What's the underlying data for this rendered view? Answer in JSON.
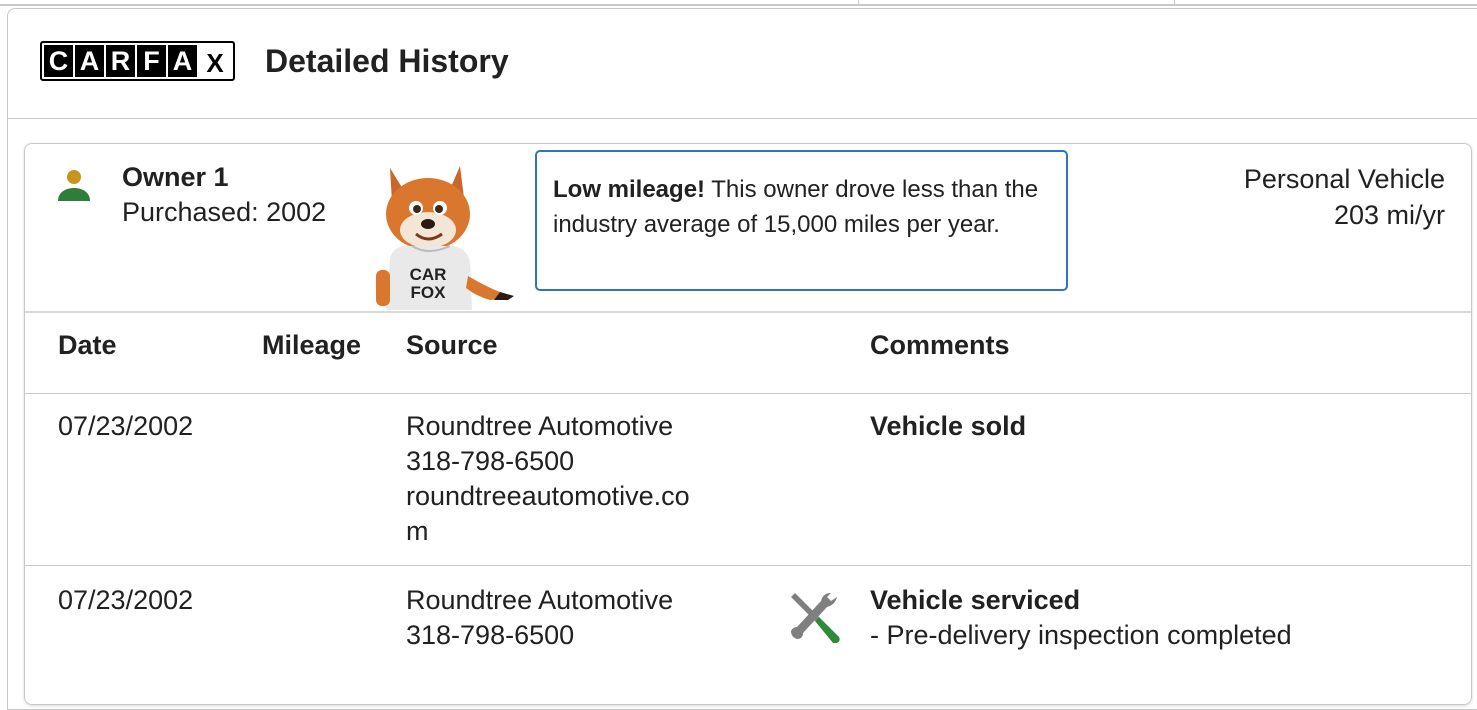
{
  "header": {
    "logo_letters": [
      "C",
      "A",
      "R",
      "F",
      "A",
      "X"
    ],
    "title": "Detailed History"
  },
  "owner": {
    "label": "Owner 1",
    "purchased": "Purchased: 2002",
    "callout_bold": "Low mileage!",
    "callout_text": " This owner drove less than the industry average of 15,000 miles per year.",
    "usage_type": "Personal Vehicle",
    "usage_rate": "203 mi/yr",
    "fox_shirt": "CAR FOX"
  },
  "table": {
    "headers": {
      "date": "Date",
      "mileage": "Mileage",
      "source": "Source",
      "comments": "Comments"
    },
    "rows": [
      {
        "date": "07/23/2002",
        "mileage": "",
        "source": [
          "Roundtree Automotive",
          "318-798-6500",
          "roundtreeautomotive.co",
          "m"
        ],
        "comment_title": "Vehicle sold",
        "comment_detail": ""
      },
      {
        "date": "07/23/2002",
        "mileage": "",
        "source": [
          "Roundtree Automotive",
          "318-798-6500"
        ],
        "icon": "service-wrench-icon",
        "comment_title": "Vehicle serviced",
        "comment_detail": "- Pre-delivery inspection completed"
      }
    ]
  },
  "colors": {
    "callout_border": "#2f74c0",
    "person_head": "#c8941c",
    "person_body": "#2f7d3b",
    "divider": "#c8c8c8"
  }
}
